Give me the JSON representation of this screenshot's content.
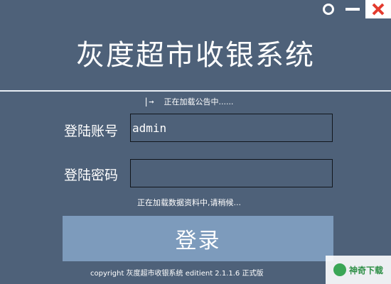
{
  "window": {
    "settings_icon": "circle-settings-icon",
    "minimize_icon": "minimize-icon",
    "close_icon": "close-icon",
    "close_color": "#e33b2e"
  },
  "app": {
    "title": "灰度超市收银系统"
  },
  "notice": {
    "icon": "|→",
    "text": "正在加载公告中......"
  },
  "login": {
    "username_label": "登陆账号",
    "username_value": "admin",
    "password_label": "登陆密码",
    "password_value": "",
    "loading_text": "正在加载数据资料中,请稍候...",
    "button_label": "登录"
  },
  "footer": {
    "copyright": "copyright 灰度超市收银系统 editient 2.1.1.6 正式版"
  },
  "watermark": {
    "text": "神奇下载"
  },
  "colors": {
    "background": "#4e6179",
    "button": "#7d9bbc"
  }
}
